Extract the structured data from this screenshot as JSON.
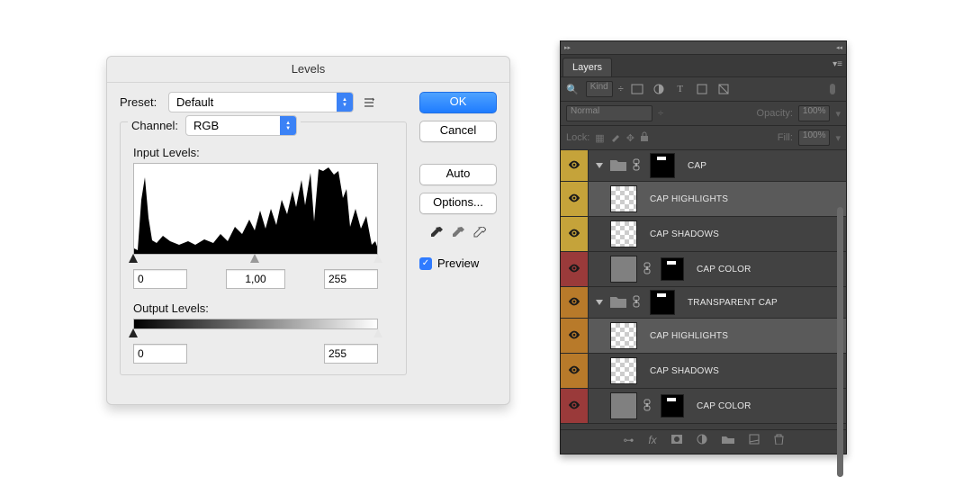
{
  "levels": {
    "title": "Levels",
    "preset_label": "Preset:",
    "preset_value": "Default",
    "channel_label": "Channel:",
    "channel_value": "RGB",
    "input_levels_label": "Input Levels:",
    "output_levels_label": "Output Levels:",
    "input": {
      "black": "0",
      "gamma": "1,00",
      "white": "255"
    },
    "output": {
      "black": "0",
      "white": "255"
    },
    "buttons": {
      "ok": "OK",
      "cancel": "Cancel",
      "auto": "Auto",
      "options": "Options..."
    },
    "preview_label": "Preview",
    "preview_checked": true
  },
  "layers": {
    "panel_title": "Layers",
    "filter_label": "Kind",
    "blend_mode": "Normal",
    "opacity_label": "Opacity:",
    "opacity_value": "100%",
    "lock_label": "Lock:",
    "fill_label": "Fill:",
    "fill_value": "100%",
    "rows": [
      {
        "kind": "group",
        "color": "#c5a33a",
        "name": "CAP",
        "indent": 0,
        "selected": false
      },
      {
        "kind": "layer",
        "color": "#c5a33a",
        "name": "CAP HIGHLIGHTS",
        "indent": 1,
        "selected": true,
        "thumb": "checker"
      },
      {
        "kind": "layer",
        "color": "#c5a33a",
        "name": "CAP SHADOWS",
        "indent": 1,
        "selected": false,
        "thumb": "checker"
      },
      {
        "kind": "masked",
        "color": "#9a3a3a",
        "name": "CAP COLOR",
        "indent": 1,
        "selected": false,
        "thumb": "gray"
      },
      {
        "kind": "group",
        "color": "#b87a2a",
        "name": "TRANSPARENT CAP",
        "indent": 0,
        "selected": false
      },
      {
        "kind": "layer",
        "color": "#b87a2a",
        "name": "CAP HIGHLIGHTS",
        "indent": 1,
        "selected": true,
        "thumb": "checker"
      },
      {
        "kind": "layer",
        "color": "#b87a2a",
        "name": "CAP SHADOWS",
        "indent": 1,
        "selected": false,
        "thumb": "checker"
      },
      {
        "kind": "masked",
        "color": "#9a3a3a",
        "name": "CAP COLOR",
        "indent": 1,
        "selected": false,
        "thumb": "gray"
      }
    ]
  }
}
